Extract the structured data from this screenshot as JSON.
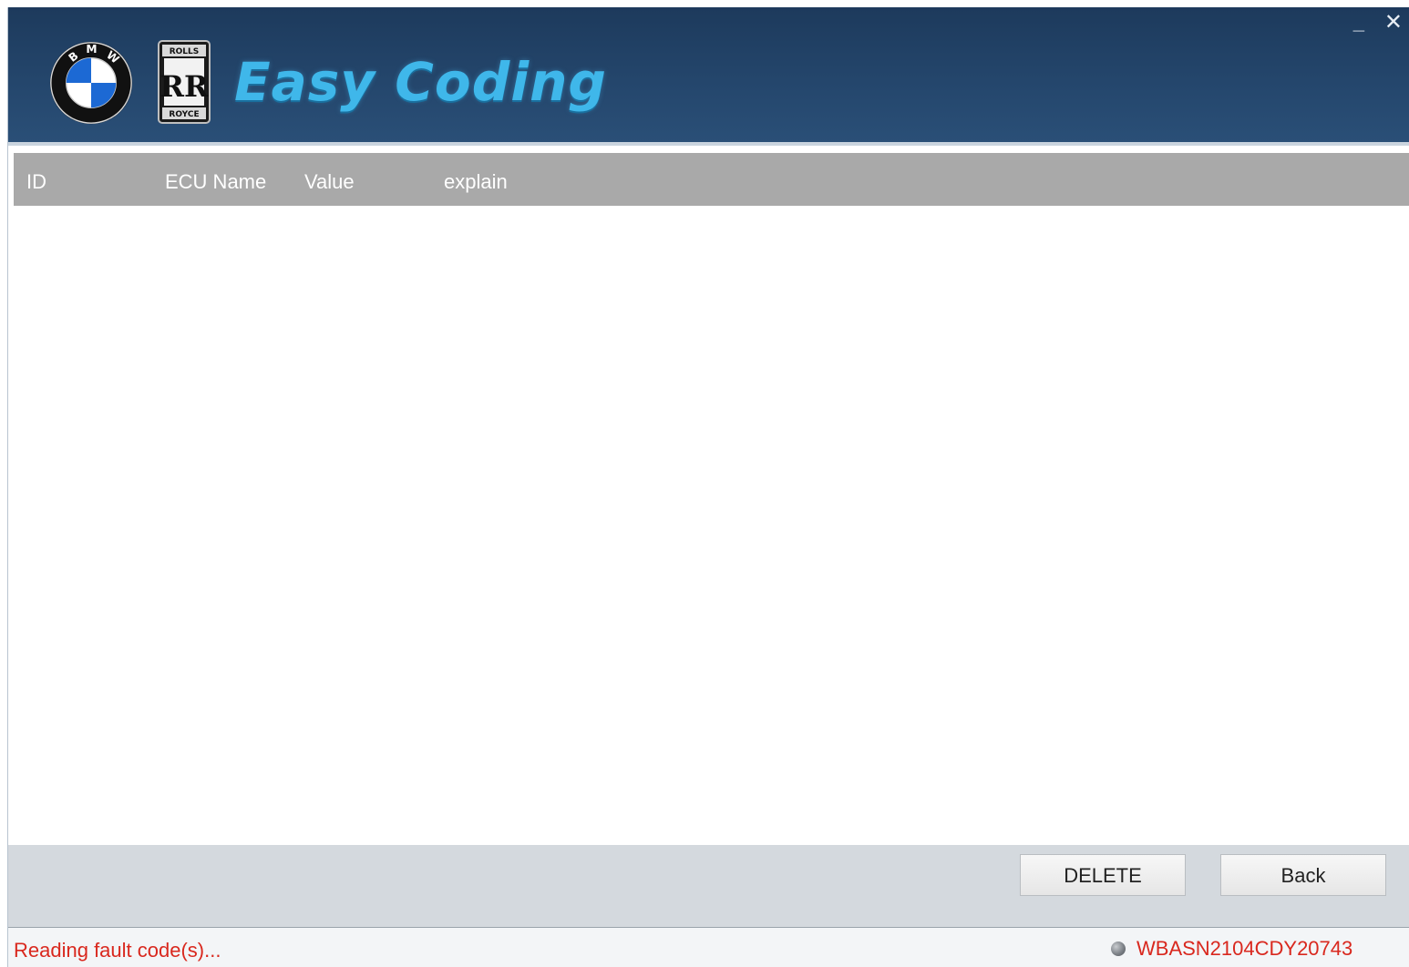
{
  "window": {
    "brand": "Easy Coding",
    "minimize_symbol": "_",
    "close_symbol": "✕",
    "logos": [
      "bmw-logo",
      "rolls-royce-logo"
    ],
    "bmw_logo_text": "BMW",
    "rr_logo_top": "ROLLS",
    "rr_logo_bottom": "ROYCE",
    "rr_logo_mono": "RR"
  },
  "table": {
    "columns": [
      "ID",
      "ECU Name",
      "Value",
      "explain"
    ],
    "rows": []
  },
  "buttons": {
    "delete": "DELETE",
    "back": "Back"
  },
  "status": {
    "message": "Reading fault code(s)...",
    "vin": "WBASN2104CDY20743"
  },
  "colors": {
    "titlebar": "#24466c",
    "brand": "#3fb7ea",
    "status_text": "#d9281e",
    "header_bg": "#a9a9a9",
    "button_bar": "#d4d9de"
  }
}
